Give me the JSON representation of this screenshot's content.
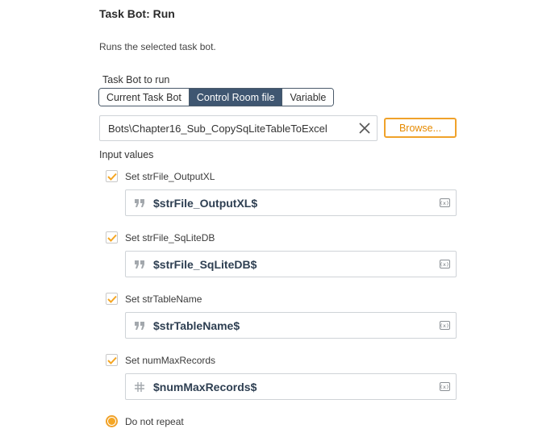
{
  "header": {
    "title": "Task Bot: Run",
    "description": "Runs the selected task bot."
  },
  "taskbot": {
    "label": "Task Bot to run",
    "options": [
      {
        "label": "Current Task Bot",
        "selected": false
      },
      {
        "label": "Control Room file",
        "selected": true
      },
      {
        "label": "Variable",
        "selected": false
      }
    ],
    "file_path": "Bots\\Chapter16_Sub_CopySqLiteTableToExcel",
    "browse_label": "Browse..."
  },
  "inputs": {
    "label": "Input values",
    "items": [
      {
        "checkbox_label": "Set strFile_OutputXL",
        "value": "$strFile_OutputXL$",
        "icon": "quote-icon",
        "checked": true
      },
      {
        "checkbox_label": "Set strFile_SqLiteDB",
        "value": "$strFile_SqLiteDB$",
        "icon": "quote-icon",
        "checked": true
      },
      {
        "checkbox_label": "Set strTableName",
        "value": "$strTableName$",
        "icon": "quote-icon",
        "checked": true
      },
      {
        "checkbox_label": "Set numMaxRecords",
        "value": "$numMaxRecords$",
        "icon": "hash-icon",
        "checked": true
      }
    ],
    "variable_icon_text": "(x)"
  },
  "repeat": {
    "label": "Do not repeat",
    "selected": true
  },
  "colors": {
    "accent_orange": "#f5a623",
    "active_tab": "#3f5671",
    "variable_text": "#2e3f52"
  }
}
